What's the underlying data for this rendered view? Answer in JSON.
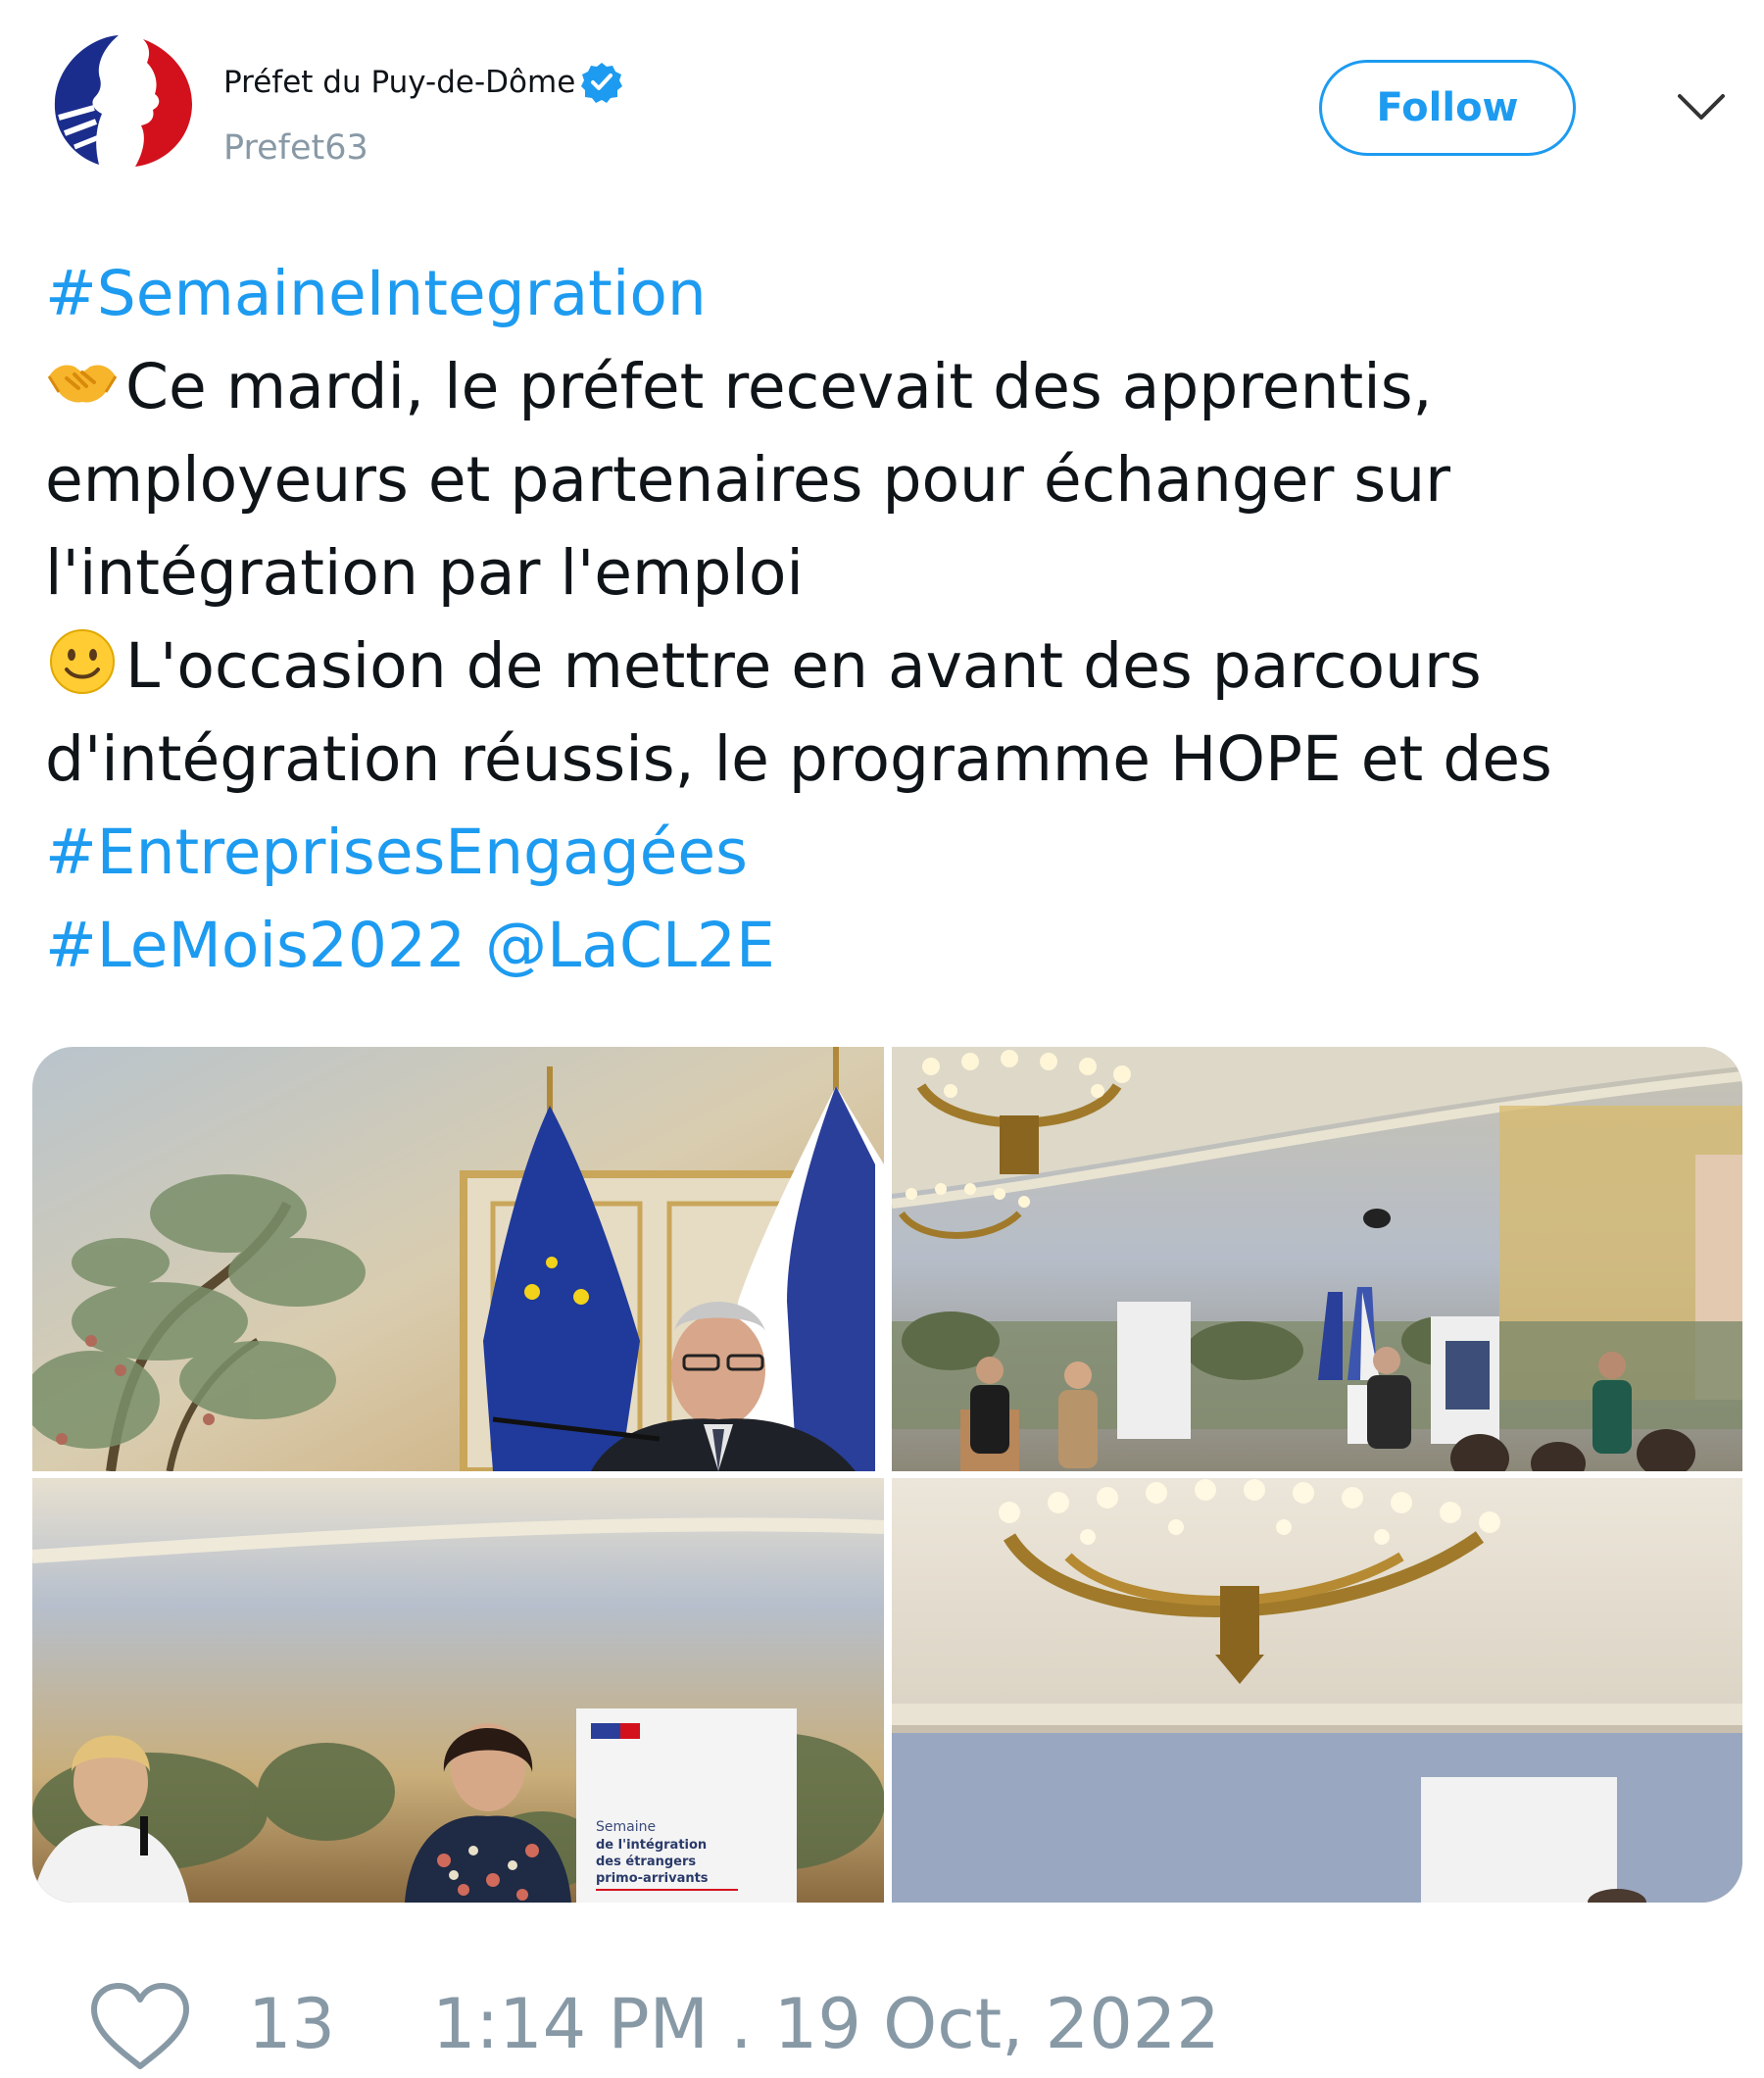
{
  "author": {
    "display_name": "Préfet du Puy-de-Dôme",
    "handle": "Prefet63",
    "verified": true,
    "avatar_icon": "marianne-logo-icon"
  },
  "header": {
    "follow_label": "Follow",
    "more_icon": "chevron-down-icon"
  },
  "tweet": {
    "line1_hashtag": "#SemaineIntegration",
    "line2_emoji": "handshake-emoji",
    "line2_text": "Ce mardi, le préfet recevait des apprentis,",
    "line3_text": "employeurs et partenaires pour échanger sur",
    "line4_text": "l'intégration par l'emploi",
    "line5_emoji": "smiling-face-emoji",
    "line5_text": "L'occasion de mettre en avant des parcours",
    "line6_text": "d'intégration réussis, le programme HOPE et des",
    "line7_hashtag": "#EntreprisesEngagées",
    "line8_hashtag": "#LeMois2022",
    "line8_mention": "@LaCL2E"
  },
  "media": {
    "photo3_banner": {
      "title": "Semaine",
      "line2": "de l'intégration",
      "line3": "des étrangers",
      "line4": "primo-arrivants"
    }
  },
  "footer": {
    "like_icon": "heart-icon",
    "like_count": "13",
    "timestamp": "1:14 PM . 19 Oct, 2022"
  },
  "colors": {
    "link": "#1d9bf0",
    "muted": "#8899a6",
    "text": "#0f1419"
  }
}
